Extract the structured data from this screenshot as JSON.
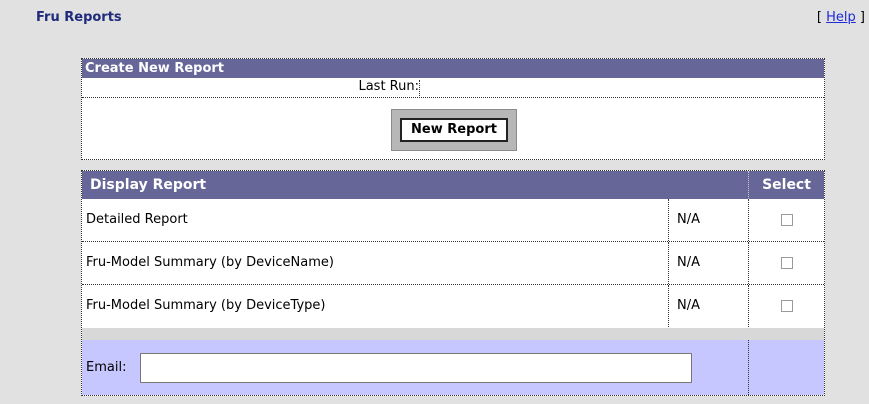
{
  "header": {
    "title": "Fru Reports",
    "help_open": "[",
    "help_label": "Help",
    "help_close": "]"
  },
  "create_panel": {
    "title": "Create New Report",
    "last_run_label": "Last Run:",
    "last_run_value": "",
    "new_report_button": "New Report"
  },
  "display_panel": {
    "title": "Display Report",
    "select_header": "Select",
    "rows": [
      {
        "name": "Detailed Report",
        "status": "N/A",
        "checked": false
      },
      {
        "name": "Fru-Model Summary (by DeviceName)",
        "status": "N/A",
        "checked": false
      },
      {
        "name": "Fru-Model Summary (by DeviceType)",
        "status": "N/A",
        "checked": false
      }
    ],
    "email_label": "Email:",
    "email_value": ""
  },
  "colors": {
    "header_bg": "#666699",
    "email_row_bg": "#c7c7ff",
    "page_bg": "#e1e1e1",
    "title_color": "#1f2a7a"
  }
}
